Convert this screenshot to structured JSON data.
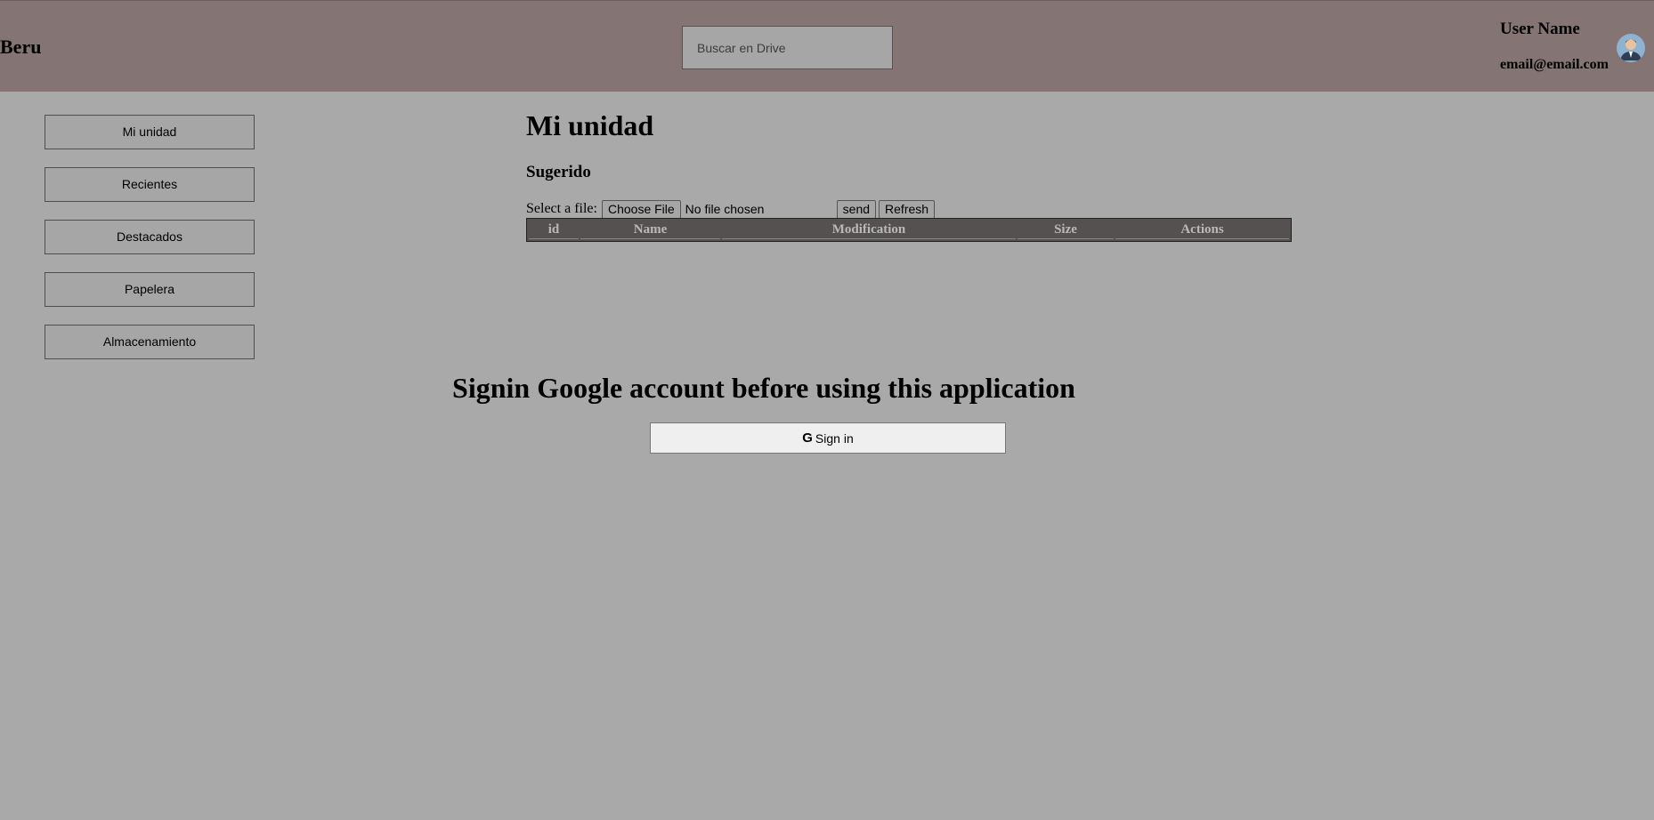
{
  "header": {
    "brand": "Beru",
    "search_placeholder": "Buscar en Drive",
    "user_name": "User Name",
    "user_email": "email@email.com",
    "avatar_icon": "user-avatar-icon"
  },
  "sidebar": {
    "items": [
      {
        "label": "Mi unidad"
      },
      {
        "label": "Recientes"
      },
      {
        "label": "Destacados"
      },
      {
        "label": "Papelera"
      },
      {
        "label": "Almacenamiento"
      }
    ]
  },
  "main": {
    "title": "Mi unidad",
    "section": "Sugerido",
    "file_label": "Select a file:",
    "choose_file": "Choose File",
    "no_file": "No file chosen",
    "send": "send",
    "refresh": "Refresh",
    "table_headers": [
      "id",
      "Name",
      "Modification",
      "Size",
      "Actions"
    ]
  },
  "signin": {
    "message": "Signin Google account before using this application",
    "button_icon": "G",
    "button_label": "Sign in"
  }
}
